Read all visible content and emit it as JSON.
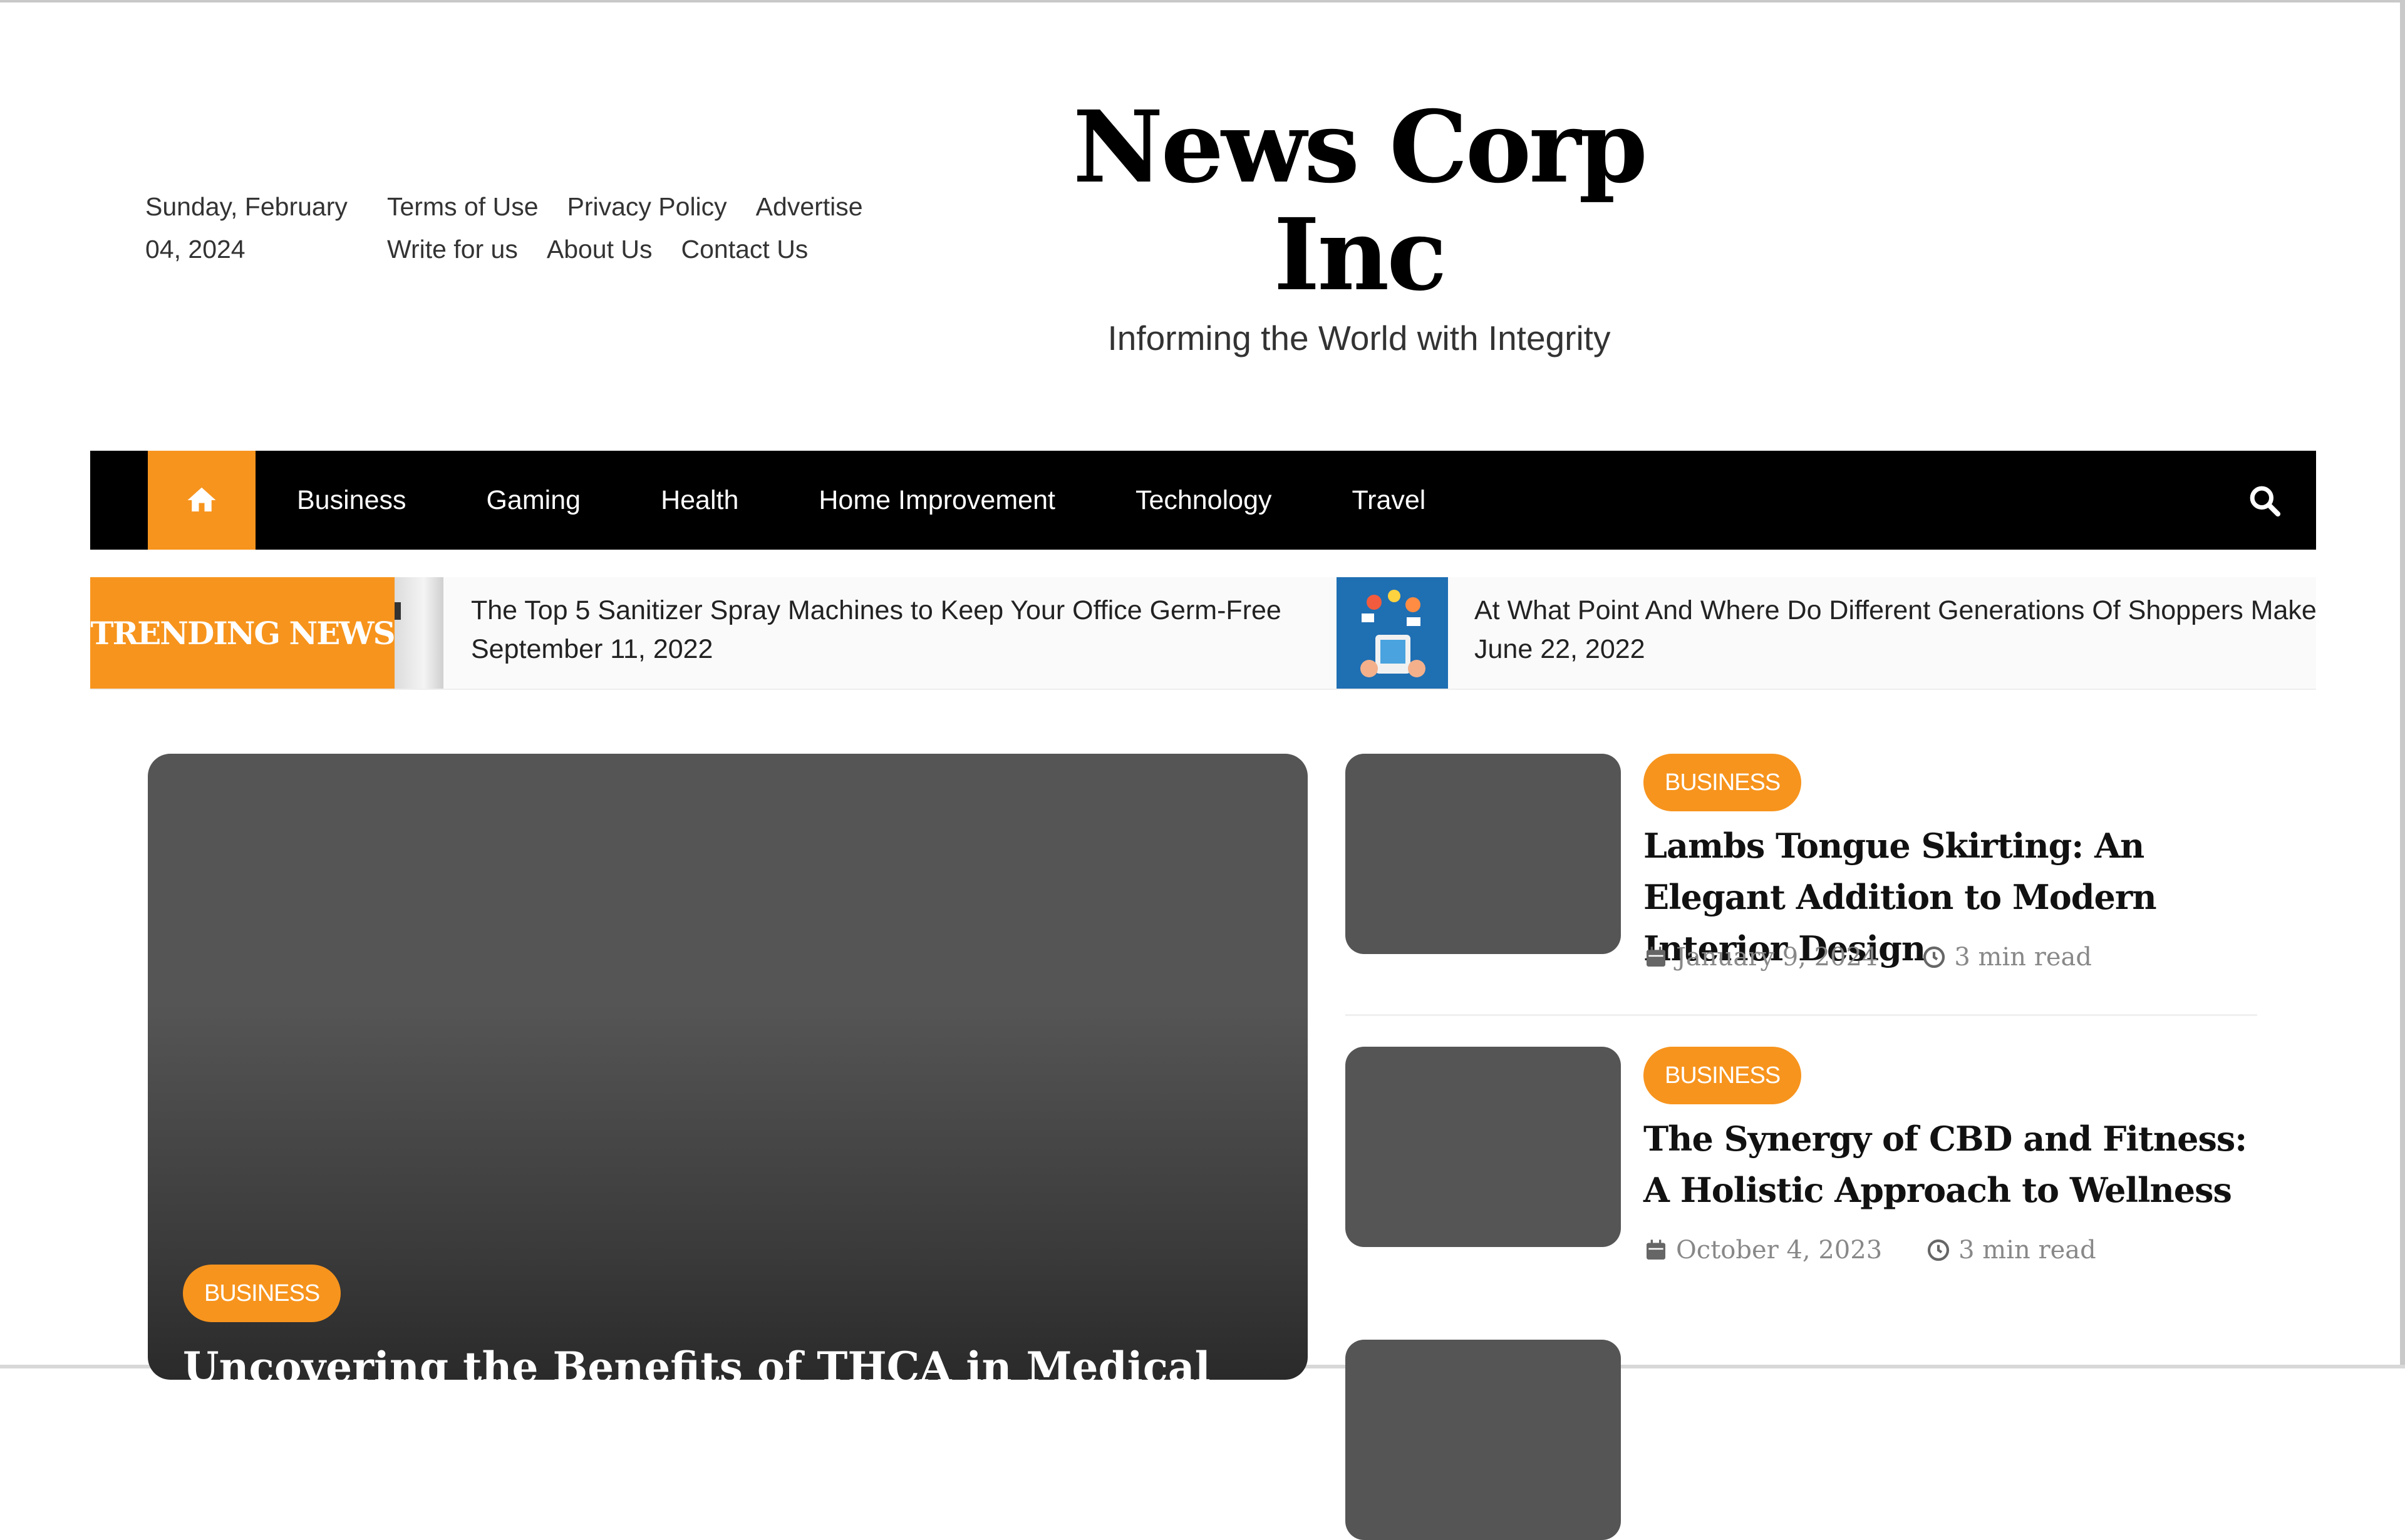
{
  "header": {
    "date": "Sunday, February 04, 2024",
    "links_row1": [
      "Terms of Use",
      "Privacy Policy",
      "Advertise"
    ],
    "links_row2": [
      "Write for us",
      "About Us",
      "Contact Us"
    ],
    "site_title": "News Corp Inc",
    "tagline": "Informing the World with Integrity"
  },
  "nav": {
    "home_icon": "home-icon",
    "items": [
      "Business",
      "Gaming",
      "Health",
      "Home Improvement",
      "Technology",
      "Travel"
    ],
    "search_icon": "search-icon"
  },
  "trending": {
    "label": "TRENDING NEWS",
    "items": [
      {
        "title": "The Top 5 Sanitizer Spray Machines to Keep Your Office Germ-Free",
        "date": "September 11, 2022"
      },
      {
        "title": "At What Point And Where Do Different Generations Of Shoppers Make",
        "date": "June 22, 2022"
      }
    ]
  },
  "featured": {
    "category": "BUSINESS",
    "title": "Uncovering the Benefits of THCA in Medical"
  },
  "side_posts": [
    {
      "category": "BUSINESS",
      "title": "Lambs Tongue Skirting: An Elegant Addition to Modern Interior Design",
      "date": "January 9, 2024",
      "read_time": "3 min read"
    },
    {
      "category": "BUSINESS",
      "title": "The Synergy of CBD and Fitness: A Holistic Approach to Wellness",
      "date": "October 4, 2023",
      "read_time": "3 min read"
    }
  ],
  "colors": {
    "accent": "#f7941d",
    "nav_bg": "#000000",
    "thumb": "#555555"
  }
}
